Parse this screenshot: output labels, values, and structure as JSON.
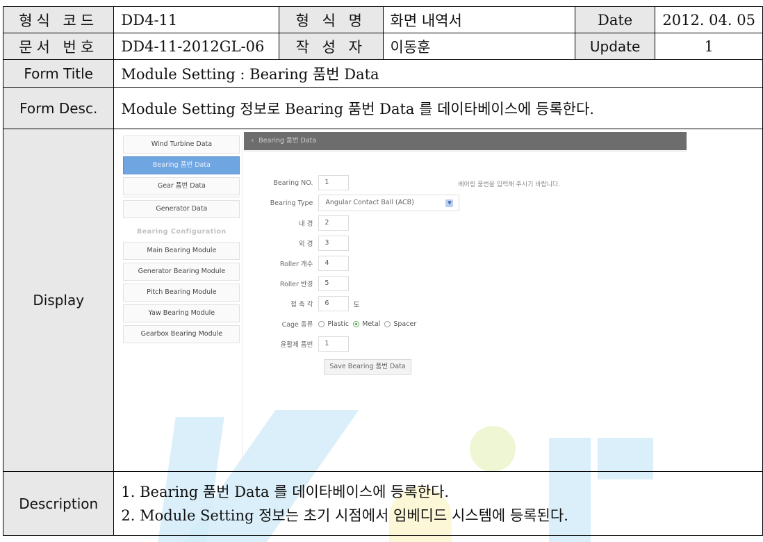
{
  "header": {
    "form_code_label": "형식 코드",
    "form_code": "DD4-11",
    "form_name_label": "형 식 명",
    "form_name": "화면 내역서",
    "date_label": "Date",
    "date": "2012. 04. 05",
    "doc_no_label": "문서 번호",
    "doc_no": "DD4-11-2012GL-06",
    "author_label": "작 성 자",
    "author": "이동훈",
    "update_label": "Update",
    "update": "1",
    "form_title_label": "Form Title",
    "form_title": "Module Setting : Bearing 품번 Data",
    "form_desc_label": "Form Desc.",
    "form_desc": "Module Setting 정보로 Bearing 품번 Data 를 데이타베이스에 등록한다.",
    "display_label": "Display",
    "description_label": "Description"
  },
  "description": [
    "1.  Bearing 품번 Data 를 데이타베이스에 등록한다.",
    "2.  Module Setting 정보는 초기 시점에서 임베디드 시스템에 등록된다."
  ],
  "app": {
    "sidebar": {
      "items": [
        {
          "label": "Wind Turbine Data",
          "active": false
        },
        {
          "label": "Bearing 품번 Data",
          "active": true
        },
        {
          "label": "Gear 품번 Data",
          "active": false
        },
        {
          "label": "Generator Data",
          "active": false
        }
      ],
      "section_title": "Bearing Configuration",
      "modules": [
        {
          "label": "Main Bearing Module"
        },
        {
          "label": "Generator Bearing Module"
        },
        {
          "label": "Pitch Bearing Module"
        },
        {
          "label": "Yaw Bearing Module"
        },
        {
          "label": "Gearbox Bearing Module"
        }
      ]
    },
    "topbar": {
      "back_icon": "‹",
      "title": "Bearing 품번 Data"
    },
    "hint": "베어링 품번을 입력해 주시기 바랍니다.",
    "form": {
      "bearing_no_label": "Bearing NO.",
      "bearing_no": "1",
      "bearing_type_label": "Bearing Type",
      "bearing_type": "Angular Contact Ball (ACB)",
      "inner_dia_label": "내 경",
      "inner_dia": "2",
      "outer_dia_label": "외 경",
      "outer_dia": "3",
      "roller_count_label": "Roller 개수",
      "roller_count": "4",
      "roller_radius_label": "Roller 반경",
      "roller_radius": "5",
      "contact_angle_label": "접 촉 각",
      "contact_angle": "6",
      "contact_angle_unit": "도",
      "cage_type_label": "Cage 종류",
      "cage_options": [
        {
          "label": "Plastic",
          "selected": false
        },
        {
          "label": "Metal",
          "selected": true
        },
        {
          "label": "Spacer",
          "selected": false
        }
      ],
      "lubricant_label": "윤활제 품번",
      "lubricant": "1",
      "save_label": "Save Bearing 품번 Data"
    }
  }
}
